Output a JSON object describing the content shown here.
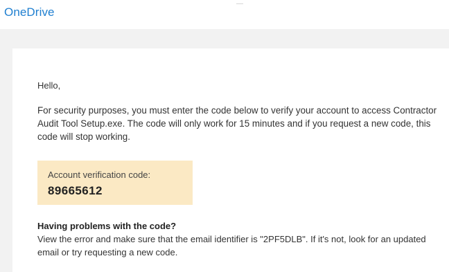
{
  "header": {
    "brand": "OneDrive"
  },
  "email": {
    "greeting": "Hello,",
    "intro": "For security purposes, you must enter the code below to verify your account to access Contractor Audit Tool Setup.exe. The code will only work for 15 minutes and if you request a new code, this code will stop working.",
    "verification": {
      "label": "Account verification code:",
      "code": "89665612"
    },
    "problems": {
      "title": "Having problems with the code?",
      "body": "View the error and make sure that the email identifier is \"2PF5DLB\". If it's not, look for an updated email or try requesting a new code."
    }
  },
  "colors": {
    "brand": "#1f7fd0",
    "code_box": "#fbe9c4",
    "background_band": "#f2f2f2"
  }
}
